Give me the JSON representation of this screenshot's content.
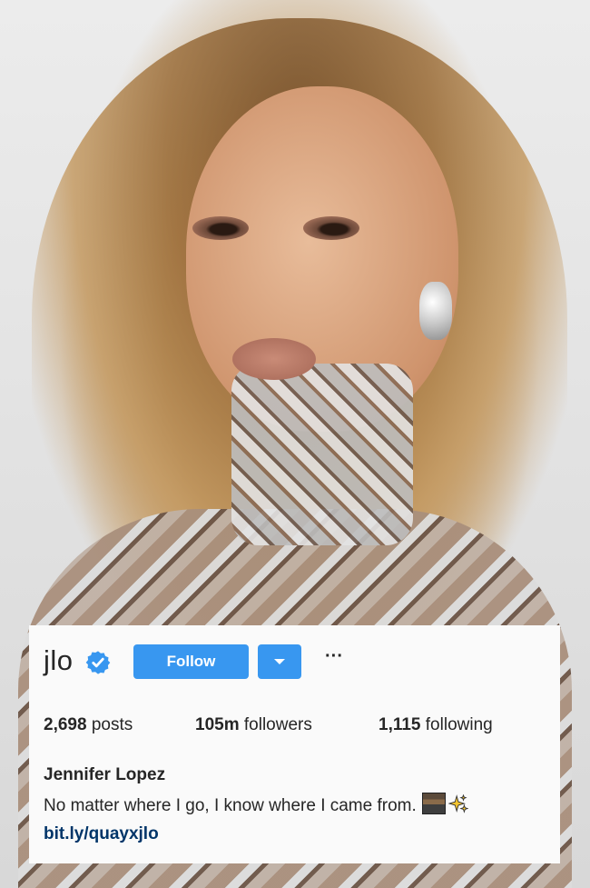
{
  "profile": {
    "username": "jlo",
    "verified_icon": "verified-badge-icon",
    "follow_label": "Follow",
    "dropdown_icon": "chevron-down-icon",
    "more_label": "···",
    "stats": {
      "posts_count": "2,698",
      "posts_label": "posts",
      "followers_count": "105m",
      "followers_label": "followers",
      "following_count": "1,115",
      "following_label": "following"
    },
    "full_name": "Jennifer Lopez",
    "bio": "No matter where I go, I know where I came from.",
    "bio_emojis": [
      "cityscape-emoji",
      "sparkles-emoji"
    ],
    "link": "bit.ly/quayxjlo"
  },
  "colors": {
    "accent": "#3897f0",
    "link": "#003569",
    "text": "#262626",
    "card_bg": "#fafafa"
  }
}
